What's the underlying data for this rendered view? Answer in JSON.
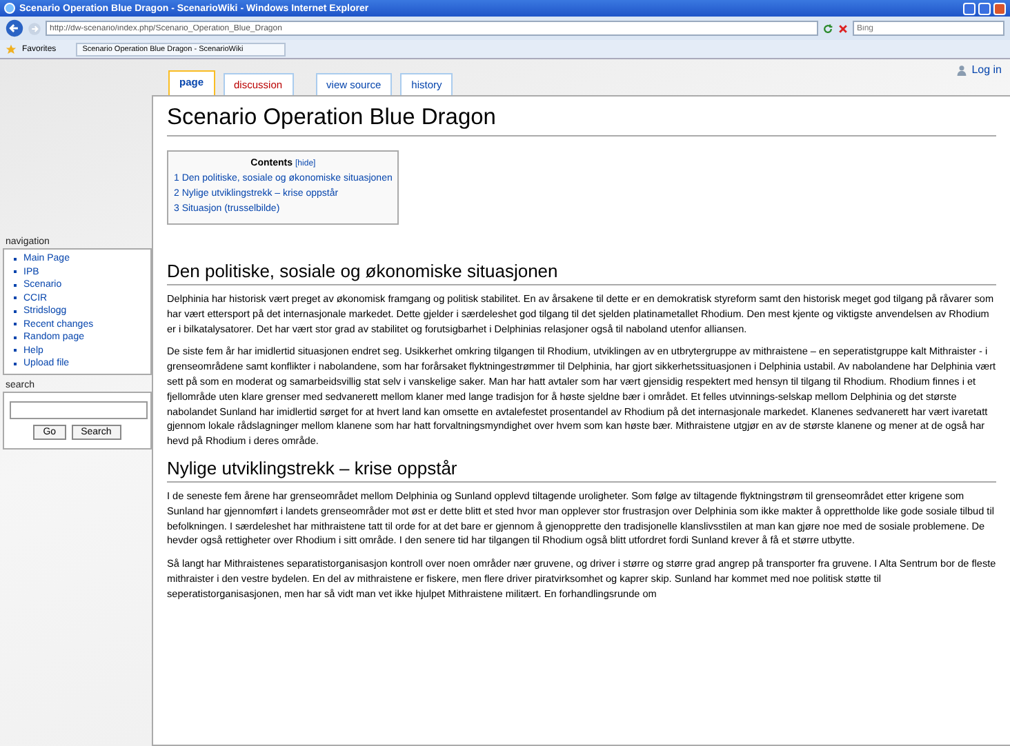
{
  "window": {
    "title": "Scenario Operation Blue Dragon - ScenarioWiki - Windows Internet Explorer"
  },
  "address_bar": {
    "value": "http://dw-scenario/index.php/Scenario_Operation_Blue_Dragon"
  },
  "search_bar": {
    "placeholder": "Bing"
  },
  "favorites_bar": {
    "label": "Favorites",
    "tab": "Scenario Operation Blue Dragon - ScenarioWiki"
  },
  "user_links": [
    "Log in"
  ],
  "page_tabs": [
    {
      "label": "page",
      "selected": true,
      "exists": true
    },
    {
      "label": "discussion",
      "selected": false,
      "exists": false
    },
    {
      "label": "view source",
      "selected": false,
      "exists": true
    },
    {
      "label": "history",
      "selected": false,
      "exists": true
    }
  ],
  "sidebar": {
    "navigation_title": "navigation",
    "items": [
      "Main Page",
      "IPB",
      "Scenario",
      "CCIR",
      "Stridslogg",
      "Recent changes",
      "Random page",
      "Help",
      "Upload file"
    ],
    "search_title": "search",
    "buttons": [
      "Go",
      "Search"
    ]
  },
  "page": {
    "title": "Scenario Operation Blue Dragon",
    "toc": {
      "title": "Contents",
      "toggle": "[hide]",
      "items": [
        "1 Den politiske, sosiale og økonomiske situasjonen",
        "2 Nylige utviklingstrekk – krise oppstår",
        "3 Situasjon (trusselbilde)"
      ]
    },
    "sections": [
      {
        "heading": "Den politiske, sosiale og økonomiske situasjonen",
        "paragraphs": [
          "Delphinia har historisk vært preget av økonomisk framgang og politisk stabilitet. En av årsakene til dette er en demokratisk styreform samt den historisk meget god tilgang på råvarer som har vært ettersport på det internasjonale markedet. Dette gjelder i særdeleshet god tilgang til det sjelden platinametallet Rhodium. Den mest kjente og viktigste anvendelsen av Rhodium er i bilkatalysatorer. Det har vært stor grad av stabilitet og forutsigbarhet i Delphinias relasjoner også til naboland utenfor alliansen.",
          "De siste fem år har imidlertid situasjonen endret seg. Usikkerhet omkring tilgangen til Rhodium, utviklingen av en utbrytergruppe av mithraistene – en seperatistgruppe kalt Mithraister - i grenseområdene samt konflikter i nabolandene, som har forårsaket flyktningestrømmer til Delphinia, har gjort sikkerhetssituasjonen i Delphinia ustabil. Av nabolandene har Delphinia vært sett på som en moderat og samarbeidsvillig stat selv i vanskelige saker. Man har hatt avtaler som har vært gjensidig respektert med hensyn til tilgang til Rhodium. Rhodium finnes i et fjellområde uten klare grenser med sedvanerett mellom klaner med lange tradisjon for å høste sjeldne bær i området. Et felles utvinnings-selskap mellom Delphinia og det største nabolandet Sunland har imidlertid sørget for at hvert land kan omsette en avtalefestet prosentandel av Rhodium på det internasjonale markedet. Klanenes sedvanerett har vært ivaretatt gjennom lokale rådslagninger mellom klanene som har hatt forvaltningsmyndighet over hvem som kan høste bær. Mithraistene utgjør en av de største klanene og mener at de også har hevd på Rhodium i deres område."
        ]
      },
      {
        "heading": "Nylige utviklingstrekk – krise oppstår",
        "paragraphs": [
          "I de seneste fem årene har grenseområdet mellom Delphinia og Sunland opplevd tiltagende uroligheter. Som følge av tiltagende flyktningstrøm til grenseområdet etter krigene som Sunland har gjennomført i landets grenseområder mot øst er dette blitt et sted hvor man opplever stor frustrasjon over Delphinia som ikke makter å opprettholde like gode sosiale tilbud til befolkningen. I særdeleshet har mithraistene tatt til orde for at det bare er gjennom å gjenopprette den tradisjonelle klanslivsstilen at man kan gjøre noe med de sosiale problemene. De hevder også rettigheter over Rhodium i sitt område. I den senere tid har tilgangen til Rhodium også blitt utfordret fordi Sunland krever å få et større utbytte.",
          "Så langt har Mithraistenes separatistorganisasjon kontroll over noen områder nær gruvene, og driver i større og større grad angrep på transporter fra gruvene. I Alta Sentrum bor de fleste mithraister i den vestre bydelen. En del av mithraistene er fiskere, men flere driver piratvirksomhet og kaprer skip. Sunland har kommet med noe politisk støtte til seperatistorganisasjonen, men har så vidt man vet ikke hjulpet Mithraistene militært. En forhandlingsrunde om"
        ]
      }
    ]
  }
}
